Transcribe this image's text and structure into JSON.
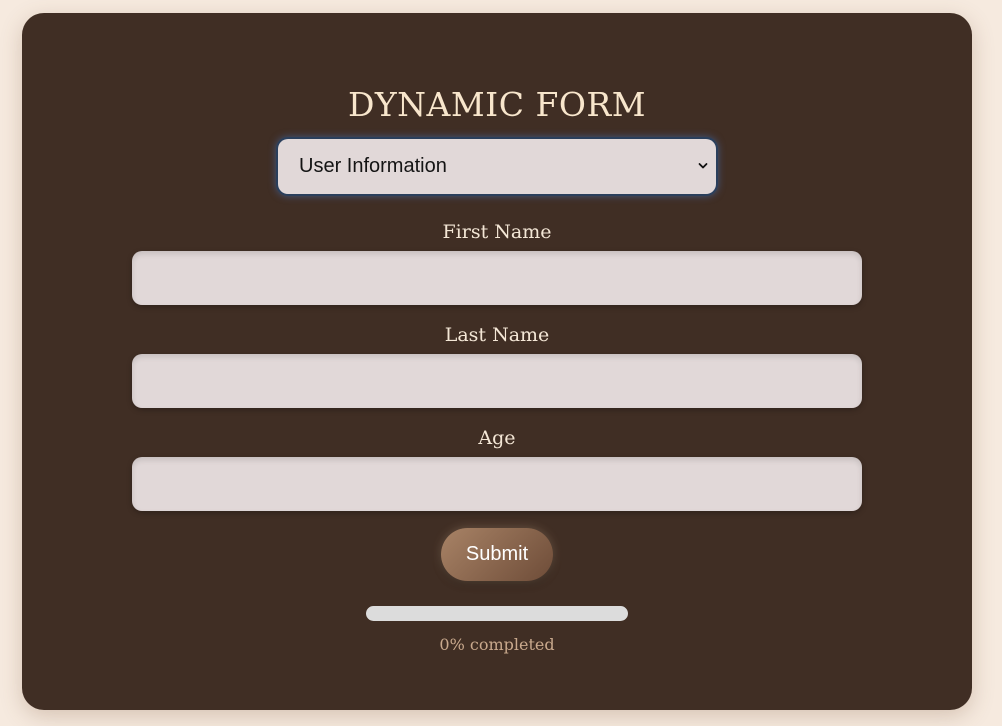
{
  "form": {
    "title": "DYNAMIC FORM",
    "section_select": {
      "selected": "User Information"
    },
    "fields": [
      {
        "label": "First Name",
        "value": ""
      },
      {
        "label": "Last Name",
        "value": ""
      },
      {
        "label": "Age",
        "value": ""
      }
    ],
    "submit_label": "Submit",
    "progress": {
      "percent": 0,
      "text": "0% completed"
    }
  },
  "colors": {
    "page_background": "#f6eadf",
    "card_background": "#402e24",
    "title_text": "#f8e6cc",
    "input_background": "#e1d8d8",
    "button_gradient_start": "#a88366",
    "button_gradient_end": "#6e4c38",
    "progress_track": "#dcdcdc",
    "progress_text": "#c9a98d",
    "focus_ring": "#4678c8"
  },
  "icons": {
    "select_arrow": "chevron-down-icon"
  }
}
